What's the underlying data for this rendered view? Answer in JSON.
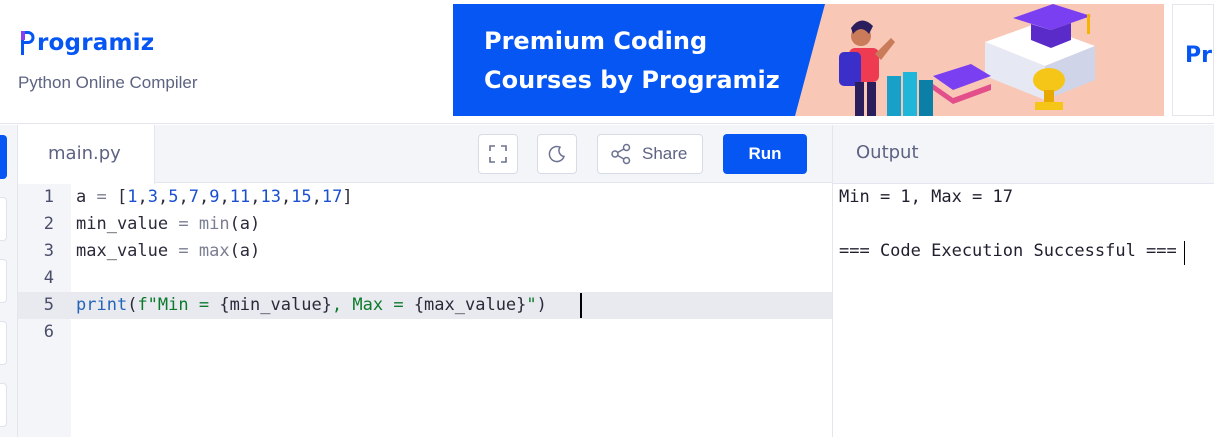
{
  "header": {
    "logo_text": "rogramiz",
    "logo_mark_letter": "P",
    "subtitle": "Python Online Compiler"
  },
  "banner": {
    "line1": "Premium Coding",
    "line2": "Courses by Programiz",
    "partial_banner_text": "Pro"
  },
  "rail": {
    "active_index": 0,
    "accent": "#0556f3"
  },
  "toolbar": {
    "file_tab": "main.py",
    "fullscreen_icon": "fullscreen-icon",
    "theme_icon": "moon-icon",
    "share_label": "Share",
    "share_icon": "share-icon",
    "run_label": "Run"
  },
  "editor": {
    "active_line": 5,
    "lines": [
      {
        "num": "1",
        "tokens": [
          {
            "t": "a",
            "c": "var"
          },
          {
            "t": " = ",
            "c": "op"
          },
          {
            "t": "[",
            "c": "var"
          },
          {
            "t": "1",
            "c": "num"
          },
          {
            "t": ",",
            "c": "var"
          },
          {
            "t": "3",
            "c": "num"
          },
          {
            "t": ",",
            "c": "var"
          },
          {
            "t": "5",
            "c": "num"
          },
          {
            "t": ",",
            "c": "var"
          },
          {
            "t": "7",
            "c": "num"
          },
          {
            "t": ",",
            "c": "var"
          },
          {
            "t": "9",
            "c": "num"
          },
          {
            "t": ",",
            "c": "var"
          },
          {
            "t": "11",
            "c": "num"
          },
          {
            "t": ",",
            "c": "var"
          },
          {
            "t": "13",
            "c": "num"
          },
          {
            "t": ",",
            "c": "var"
          },
          {
            "t": "15",
            "c": "num"
          },
          {
            "t": ",",
            "c": "var"
          },
          {
            "t": "17",
            "c": "num"
          },
          {
            "t": "]",
            "c": "var"
          }
        ]
      },
      {
        "num": "2",
        "tokens": [
          {
            "t": "min_value",
            "c": "var"
          },
          {
            "t": " = ",
            "c": "op"
          },
          {
            "t": "min",
            "c": "op"
          },
          {
            "t": "(a)",
            "c": "var"
          }
        ]
      },
      {
        "num": "3",
        "tokens": [
          {
            "t": "max_value",
            "c": "var"
          },
          {
            "t": " = ",
            "c": "op"
          },
          {
            "t": "max",
            "c": "op"
          },
          {
            "t": "(a)",
            "c": "var"
          }
        ]
      },
      {
        "num": "4",
        "tokens": []
      },
      {
        "num": "5",
        "tokens": [
          {
            "t": "print",
            "c": "fn"
          },
          {
            "t": "(",
            "c": "var"
          },
          {
            "t": "f\"Min = ",
            "c": "str"
          },
          {
            "t": "{min_value}",
            "c": "var"
          },
          {
            "t": ", Max = ",
            "c": "str"
          },
          {
            "t": "{max_value}",
            "c": "var"
          },
          {
            "t": "\"",
            "c": "str"
          },
          {
            "t": ")",
            "c": "var"
          }
        ]
      },
      {
        "num": "6",
        "tokens": []
      }
    ]
  },
  "output": {
    "title": "Output",
    "lines": [
      "Min = 1, Max = 17",
      "",
      "=== Code Execution Successful ==="
    ]
  }
}
